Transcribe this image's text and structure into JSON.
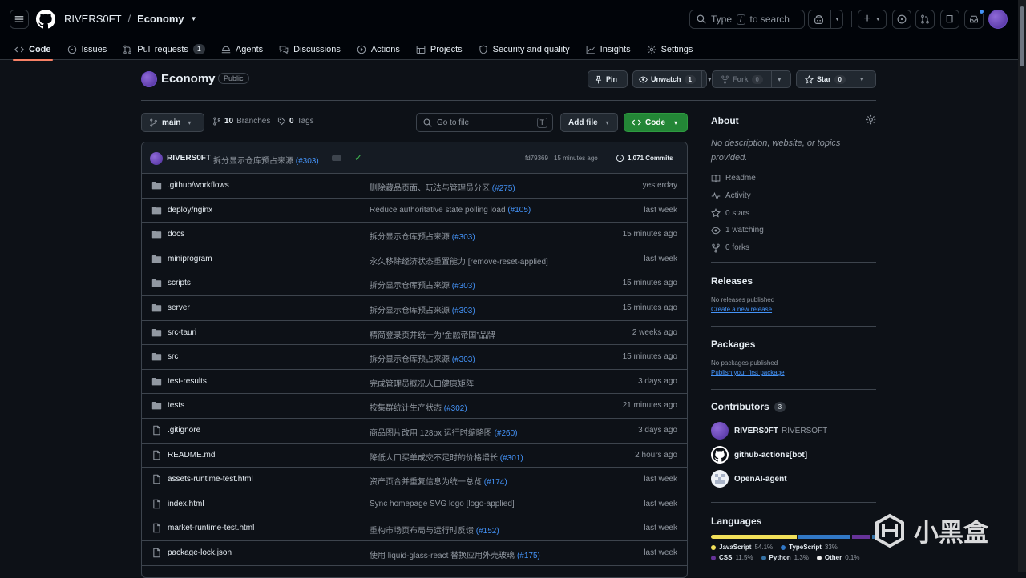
{
  "header": {
    "owner": "RIVERS0FT",
    "separator": "/",
    "repo": "Economy",
    "search_prefix": "Type",
    "search_key": "/",
    "search_suffix": "to search"
  },
  "tabs": [
    {
      "label": "Code",
      "icon": "code-icon",
      "selected": true
    },
    {
      "label": "Issues",
      "icon": "issue-icon"
    },
    {
      "label": "Pull requests",
      "icon": "pull-request-icon",
      "count": "1"
    },
    {
      "label": "Agents",
      "icon": "agents-icon"
    },
    {
      "label": "Discussions",
      "icon": "discussion-icon"
    },
    {
      "label": "Actions",
      "icon": "play-icon"
    },
    {
      "label": "Projects",
      "icon": "table-icon"
    },
    {
      "label": "Security and quality",
      "icon": "shield-icon"
    },
    {
      "label": "Insights",
      "icon": "graph-icon"
    },
    {
      "label": "Settings",
      "icon": "gear-icon"
    }
  ],
  "repo_header": {
    "name": "Economy",
    "visibility": "Public",
    "pin_label": "Pin",
    "watch_label": "Unwatch",
    "watch_count": "1",
    "fork_label": "Fork",
    "fork_count": "0",
    "star_label": "Star",
    "star_count": "0"
  },
  "toolbar": {
    "branch": "main",
    "branches_count": "10",
    "branches_label": "Branches",
    "tags_count": "0",
    "tags_label": "Tags",
    "goto_placeholder": "Go to file",
    "goto_key": "T",
    "add_file_label": "Add file",
    "code_label": "Code"
  },
  "latest_commit": {
    "user": "RIVERS0FT",
    "message": "拆分显示仓库预占来源",
    "ref": "(#303)",
    "hash_time": "fd79369 · 15 minutes ago",
    "commits": "1,071 Commits"
  },
  "files": [
    {
      "type": "dir",
      "name": ".github/workflows",
      "msg": "删除藏品页面、玩法与管理员分区",
      "ref": "(#275)",
      "time": "yesterday"
    },
    {
      "type": "dir",
      "name": "deploy/nginx",
      "msg": "Reduce authoritative state polling load",
      "ref": "(#105)",
      "time": "last week"
    },
    {
      "type": "dir",
      "name": "docs",
      "msg": "拆分显示仓库预占来源",
      "ref": "(#303)",
      "time": "15 minutes ago"
    },
    {
      "type": "dir",
      "name": "miniprogram",
      "msg": "永久移除经济状态重置能力 [remove-reset-applied]",
      "ref": "",
      "time": "last week"
    },
    {
      "type": "dir",
      "name": "scripts",
      "msg": "拆分显示仓库预占来源",
      "ref": "(#303)",
      "time": "15 minutes ago"
    },
    {
      "type": "dir",
      "name": "server",
      "msg": "拆分显示仓库预占来源",
      "ref": "(#303)",
      "time": "15 minutes ago"
    },
    {
      "type": "dir",
      "name": "src-tauri",
      "msg": "精简登录页并统一为“金融帝国”品牌",
      "ref": "",
      "time": "2 weeks ago"
    },
    {
      "type": "dir",
      "name": "src",
      "msg": "拆分显示仓库预占来源",
      "ref": "(#303)",
      "time": "15 minutes ago"
    },
    {
      "type": "dir",
      "name": "test-results",
      "msg": "完成管理员概况人口健康矩阵",
      "ref": "",
      "time": "3 days ago"
    },
    {
      "type": "dir",
      "name": "tests",
      "msg": "按集群统计生产状态",
      "ref": "(#302)",
      "time": "21 minutes ago"
    },
    {
      "type": "file",
      "name": ".gitignore",
      "msg": "商品图片改用 128px 运行时缩略图",
      "ref": "(#260)",
      "time": "3 days ago"
    },
    {
      "type": "file",
      "name": "README.md",
      "msg": "降低人口买单成交不足时的价格增长",
      "ref": "(#301)",
      "time": "2 hours ago"
    },
    {
      "type": "file",
      "name": "assets-runtime-test.html",
      "msg": "资产页合并重复信息为统一总览",
      "ref": "(#174)",
      "time": "last week"
    },
    {
      "type": "file",
      "name": "index.html",
      "msg": "Sync homepage SVG logo [logo-applied]",
      "ref": "",
      "time": "last week"
    },
    {
      "type": "file",
      "name": "market-runtime-test.html",
      "msg": "重构市场页布局与运行时反馈",
      "ref": "(#152)",
      "time": "last week"
    },
    {
      "type": "file",
      "name": "package-lock.json",
      "msg": "使用 liquid-glass-react 替换应用外壳玻璃",
      "ref": "(#175)",
      "time": "last week"
    }
  ],
  "about": {
    "title": "About",
    "description": "No description, website, or topics provided.",
    "items": [
      {
        "icon": "book-icon",
        "label": "Readme"
      },
      {
        "icon": "pulse-icon",
        "label": "Activity"
      },
      {
        "icon": "star-icon",
        "label": "0 stars"
      },
      {
        "icon": "eye-icon",
        "label": "1 watching"
      },
      {
        "icon": "fork-icon",
        "label": "0 forks"
      }
    ]
  },
  "releases": {
    "title": "Releases",
    "empty": "No releases published",
    "link": "Create a new release"
  },
  "packages": {
    "title": "Packages",
    "empty": "No packages published",
    "link": "Publish your first package"
  },
  "contributors": {
    "title": "Contributors",
    "count": "3",
    "list": [
      {
        "login": "RIVERS0FT",
        "name": "RIVERSOFT"
      },
      {
        "login": "github-actions[bot]",
        "name": ""
      },
      {
        "login": "OpenAI-agent",
        "name": ""
      }
    ]
  },
  "languages": {
    "title": "Languages",
    "list": [
      {
        "name": "JavaScript",
        "percent": "54.1%",
        "value": 54.1,
        "color": "#f1e05a"
      },
      {
        "name": "TypeScript",
        "percent": "33%",
        "value": 33,
        "color": "#3178c6"
      },
      {
        "name": "CSS",
        "percent": "11.5%",
        "value": 11.5,
        "color": "#663399"
      },
      {
        "name": "Python",
        "percent": "1.3%",
        "value": 1.3,
        "color": "#3572a5"
      },
      {
        "name": "Other",
        "percent": "0.1%",
        "value": 0.1,
        "color": "#ededed"
      }
    ]
  },
  "watermark": {
    "text": "小黑盒"
  }
}
